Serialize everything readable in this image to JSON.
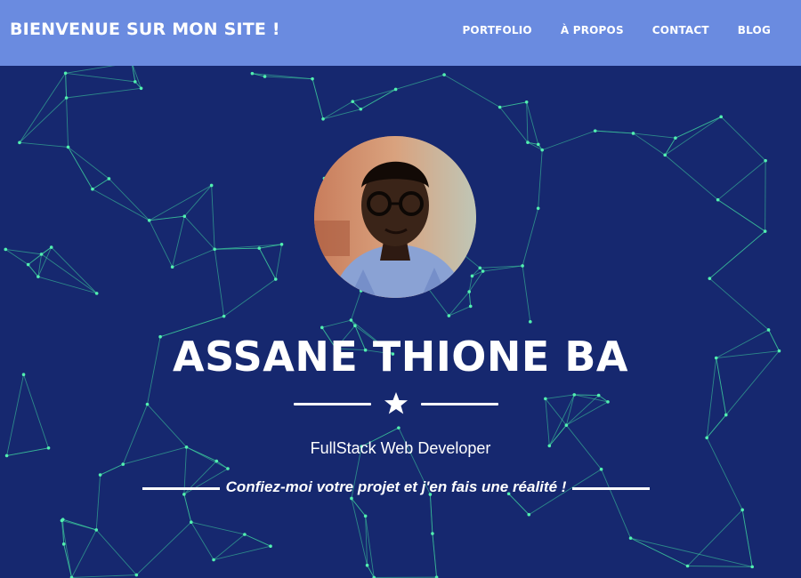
{
  "header": {
    "brand": "BIENVENUE SUR MON SITE !",
    "nav": [
      {
        "label": "PORTFOLIO"
      },
      {
        "label": "À PROPOS"
      },
      {
        "label": "CONTACT"
      },
      {
        "label": "BLOG"
      }
    ]
  },
  "hero": {
    "name": "ASSANE THIONE BA",
    "role": "FullStack Web Developer",
    "tagline": "Confiez-moi votre projet et j'en fais une réalité !",
    "divider_icon": "star-icon",
    "avatar_icon": "profile-photo"
  },
  "colors": {
    "nav_background": "#6a8be0",
    "hero_background": "#16286f",
    "network_lines": "#3fd7a0",
    "text": "#ffffff"
  }
}
